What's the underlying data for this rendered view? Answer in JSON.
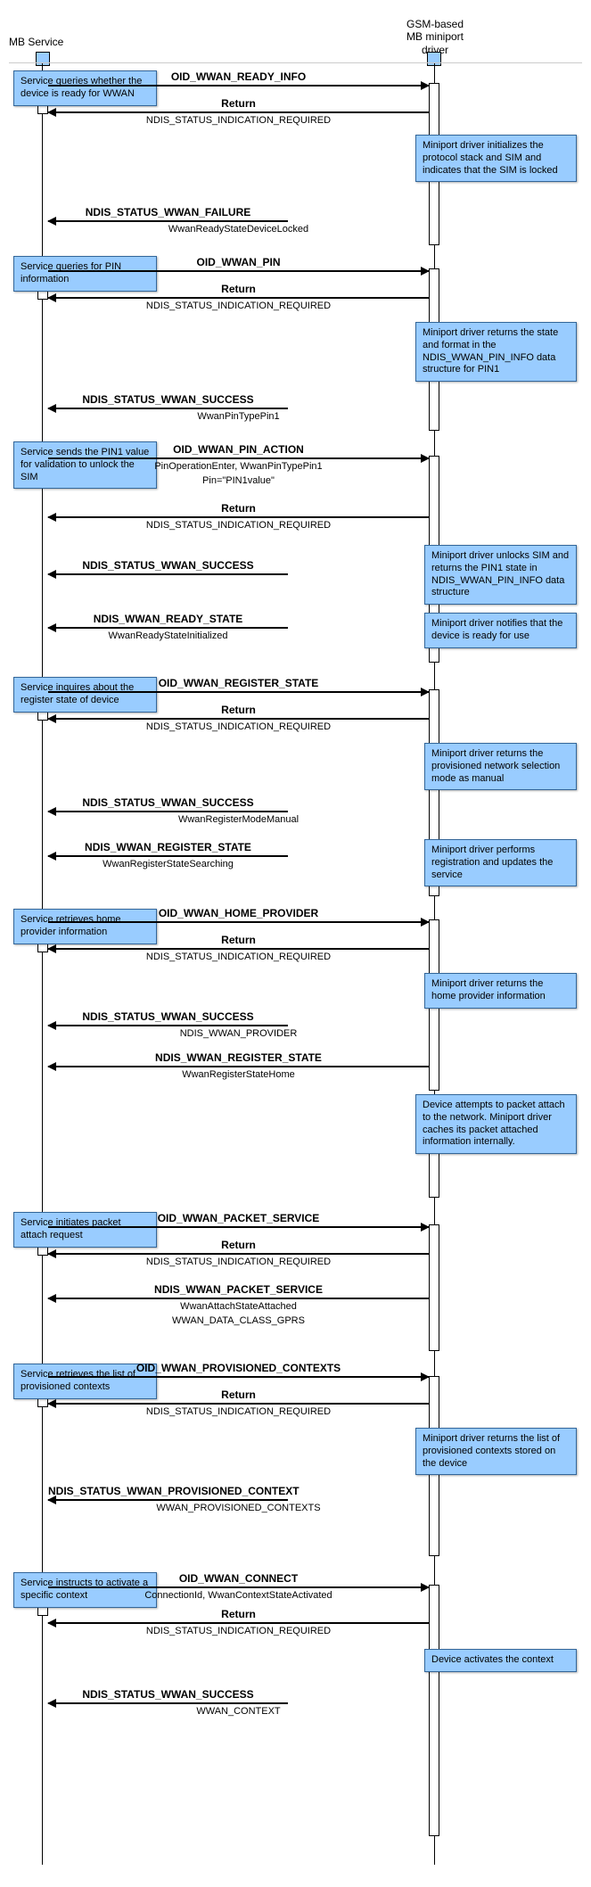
{
  "actors": {
    "left": "MB Service",
    "right": "GSM-based\nMB miniport\ndriver"
  },
  "notes": {
    "n1": "Service queries whether the device is ready for WWAN",
    "n2": "Miniport driver initializes the protocol stack and SIM and indicates that the SIM is locked",
    "n3": "Service queries for PIN information",
    "n4": "Miniport driver returns the state and format in the NDIS_WWAN_PIN_INFO data structure for PIN1",
    "n5": "Service sends the PIN1 value for validation to unlock the SIM",
    "n6": "Miniport driver unlocks SIM and returns the PIN1 state in  NDIS_WWAN_PIN_INFO data structure",
    "n7": "Miniport driver notifies that the device is ready for use",
    "n8": "Service inquires about the register state of device",
    "n9": "Miniport driver returns the provisioned network selection mode as manual",
    "n10": "Miniport driver performs registration and updates the service",
    "n11": "Service retrieves home provider information",
    "n12": "Miniport driver returns the home provider information",
    "n13": "Device attempts to packet attach to the network. Miniport driver caches its packet attached information internally.",
    "n14": "Service initiates packet attach request",
    "n15": "Service retrieves the list of provisioned contexts",
    "n16": "Miniport driver returns the list of provisioned contexts stored on the device",
    "n17": "Service instructs to activate a specific context",
    "n18": "Device activates the context"
  },
  "msgs": {
    "m1": "OID_WWAN_READY_INFO",
    "m2": "Return",
    "m3": "NDIS_STATUS_INDICATION_REQUIRED",
    "m4": "NDIS_STATUS_WWAN_FAILURE",
    "m5": "WwanReadyStateDeviceLocked",
    "m6": "OID_WWAN_PIN",
    "m7": "Return",
    "m8": "NDIS_STATUS_INDICATION_REQUIRED",
    "m9": "NDIS_STATUS_WWAN_SUCCESS",
    "m10": "WwanPinTypePin1",
    "m11": "OID_WWAN_PIN_ACTION",
    "m12": "PinOperationEnter, WwanPinTypePin1",
    "m13": "Pin=\"PIN1value\"",
    "m14": "Return",
    "m15": "NDIS_STATUS_INDICATION_REQUIRED",
    "m16": "NDIS_STATUS_WWAN_SUCCESS",
    "m17": "NDIS_WWAN_READY_STATE",
    "m18": "WwanReadyStateInitialized",
    "m19": "OID_WWAN_REGISTER_STATE",
    "m20": "Return",
    "m21": "NDIS_STATUS_INDICATION_REQUIRED",
    "m22": "NDIS_STATUS_WWAN_SUCCESS",
    "m23": "WwanRegisterModeManual",
    "m24": "NDIS_WWAN_REGISTER_STATE",
    "m25": "WwanRegisterStateSearching",
    "m26": "OID_WWAN_HOME_PROVIDER",
    "m27": "Return",
    "m28": "NDIS_STATUS_INDICATION_REQUIRED",
    "m29": "NDIS_STATUS_WWAN_SUCCESS",
    "m30": "NDIS_WWAN_PROVIDER",
    "m31": "NDIS_WWAN_REGISTER_STATE",
    "m32": "WwanRegisterStateHome",
    "m33": "OID_WWAN_PACKET_SERVICE",
    "m34": "Return",
    "m35": "NDIS_STATUS_INDICATION_REQUIRED",
    "m36": "NDIS_WWAN_PACKET_SERVICE",
    "m37": "WwanAttachStateAttached",
    "m38": "WWAN_DATA_CLASS_GPRS",
    "m39": "OID_WWAN_PROVISIONED_CONTEXTS",
    "m40": "Return",
    "m41": "NDIS_STATUS_INDICATION_REQUIRED",
    "m42": "NDIS_STATUS_WWAN_PROVISIONED_CONTEXT",
    "m43": "WWAN_PROVISIONED_CONTEXTS",
    "m44": "OID_WWAN_CONNECT",
    "m45": "ConnectionId, WwanContextStateActivated",
    "m46": "Return",
    "m47": "NDIS_STATUS_INDICATION_REQUIRED",
    "m48": "NDIS_STATUS_WWAN_SUCCESS",
    "m49": "WWAN_CONTEXT"
  }
}
